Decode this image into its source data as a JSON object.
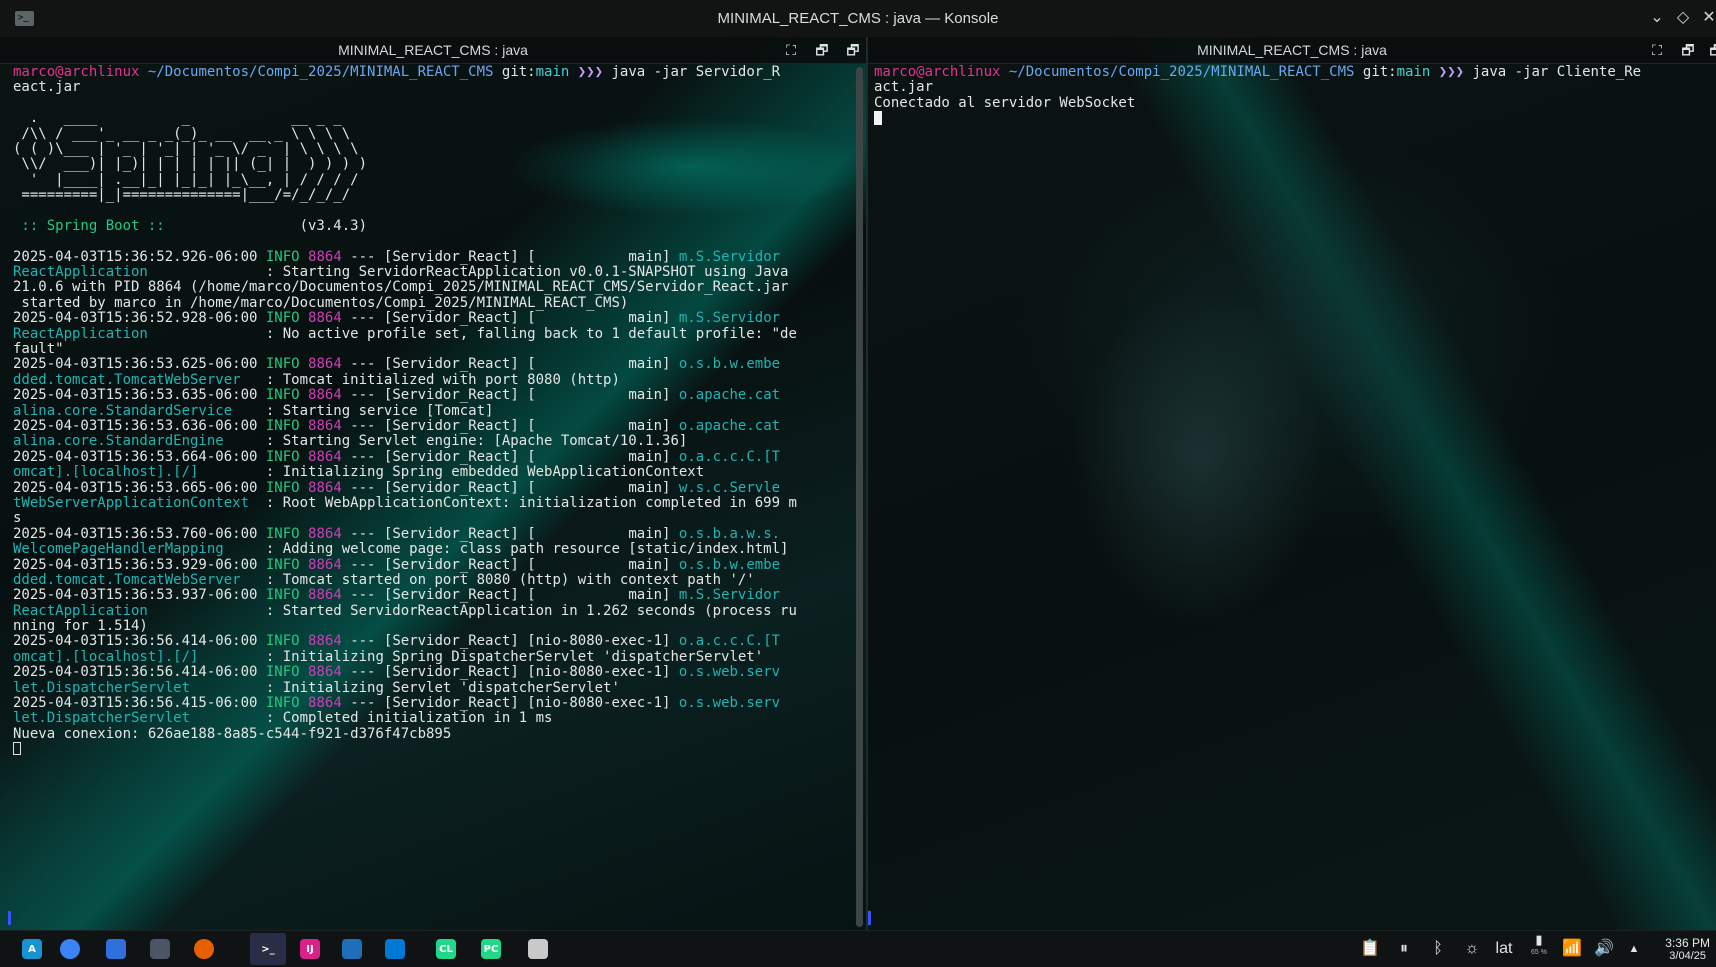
{
  "window": {
    "title": "MINIMAL_REACT_CMS : java — Konsole",
    "app_icon": "terminal-icon"
  },
  "left_pane": {
    "title": "MINIMAL_REACT_CMS : java",
    "prompt": {
      "user": "marco@archlinux",
      "path": "~/Documentos/Compi_2025/MINIMAL_REACT_CMS",
      "git": "git:",
      "branch_glyph": "",
      "branch": "main",
      "arrows": "❯❯❯",
      "command_1": "java -jar Servidor_R",
      "command_2": "eact.jar"
    },
    "banner": [
      "",
      "  .   ____          _            __ _ _",
      " /\\\\ / ___'_ __ _ _(_)_ __  __ _ \\ \\ \\ \\",
      "( ( )\\___ | '_ | '_| | '_ \\/ _` | \\ \\ \\ \\",
      " \\\\/  ___)| |_)| | | | | || (_| |  ) ) ) )",
      "  '  |____| .__|_| |_|_| |_\\__, | / / / /",
      " =========|_|==============|___/=/_/_/_/",
      ""
    ],
    "spring_label": " :: Spring Boot ::",
    "spring_version": "                (v3.4.3)",
    "logs": [
      [
        "2025-04-03T15:36:52.926-06:00",
        "INFO",
        "8864",
        "--- [Servidor_React] [           main]",
        "m.S.Servidor"
      ],
      [
        "ReactApplication             ",
        "",
        "",
        ": Starting ServidorReactApplication v0.0.1-SNAPSHOT using Java",
        ""
      ],
      [
        "21.0.6 with PID 8864 (/home/marco/Documentos/Compi_2025/MINIMAL_REACT_CMS/Servidor_React.jar",
        "",
        "",
        "",
        ""
      ],
      [
        " started by marco in /home/marco/Documentos/Compi_2025/MINIMAL_REACT_CMS)",
        "",
        "",
        "",
        ""
      ],
      [
        "2025-04-03T15:36:52.928-06:00",
        "INFO",
        "8864",
        "--- [Servidor_React] [           main]",
        "m.S.Servidor"
      ],
      [
        "ReactApplication             ",
        "",
        "",
        ": No active profile set, falling back to 1 default profile: \"de",
        ""
      ],
      [
        "fault\"",
        "",
        "",
        "",
        ""
      ],
      [
        "2025-04-03T15:36:53.625-06:00",
        "INFO",
        "8864",
        "--- [Servidor_React] [           main]",
        "o.s.b.w.embe"
      ],
      [
        "dded.tomcat.TomcatWebServer  ",
        "",
        "",
        ": Tomcat initialized with port 8080 (http)",
        ""
      ],
      [
        "2025-04-03T15:36:53.635-06:00",
        "INFO",
        "8864",
        "--- [Servidor_React] [           main]",
        "o.apache.cat"
      ],
      [
        "alina.core.StandardService   ",
        "",
        "",
        ": Starting service [Tomcat]",
        ""
      ],
      [
        "2025-04-03T15:36:53.636-06:00",
        "INFO",
        "8864",
        "--- [Servidor_React] [           main]",
        "o.apache.cat"
      ],
      [
        "alina.core.StandardEngine    ",
        "",
        "",
        ": Starting Servlet engine: [Apache Tomcat/10.1.36]",
        ""
      ],
      [
        "2025-04-03T15:36:53.664-06:00",
        "INFO",
        "8864",
        "--- [Servidor_React] [           main]",
        "o.a.c.c.C.[T"
      ],
      [
        "omcat].[localhost].[/]       ",
        "",
        "",
        ": Initializing Spring embedded WebApplicationContext",
        ""
      ],
      [
        "2025-04-03T15:36:53.665-06:00",
        "INFO",
        "8864",
        "--- [Servidor_React] [           main]",
        "w.s.c.Servle"
      ],
      [
        "tWebServerApplicationContext ",
        "",
        "",
        ": Root WebApplicationContext: initialization completed in 699 m",
        ""
      ],
      [
        "s",
        "",
        "",
        "",
        ""
      ],
      [
        "2025-04-03T15:36:53.760-06:00",
        "INFO",
        "8864",
        "--- [Servidor_React] [           main]",
        "o.s.b.a.w.s."
      ],
      [
        "WelcomePageHandlerMapping    ",
        "",
        "",
        ": Adding welcome page: class path resource [static/index.html]",
        ""
      ],
      [
        "2025-04-03T15:36:53.929-06:00",
        "INFO",
        "8864",
        "--- [Servidor_React] [           main]",
        "o.s.b.w.embe"
      ],
      [
        "dded.tomcat.TomcatWebServer  ",
        "",
        "",
        ": Tomcat started on port 8080 (http) with context path '/'",
        ""
      ],
      [
        "2025-04-03T15:36:53.937-06:00",
        "INFO",
        "8864",
        "--- [Servidor_React] [           main]",
        "m.S.Servidor"
      ],
      [
        "ReactApplication             ",
        "",
        "",
        ": Started ServidorReactApplication in 1.262 seconds (process ru",
        ""
      ],
      [
        "nning for 1.514)",
        "",
        "",
        "",
        ""
      ],
      [
        "2025-04-03T15:36:56.414-06:00",
        "INFO",
        "8864",
        "--- [Servidor_React] [nio-8080-exec-1]",
        "o.a.c.c.C.[T"
      ],
      [
        "omcat].[localhost].[/]       ",
        "",
        "",
        ": Initializing Spring DispatcherServlet 'dispatcherServlet'",
        ""
      ],
      [
        "2025-04-03T15:36:56.414-06:00",
        "INFO",
        "8864",
        "--- [Servidor_React] [nio-8080-exec-1]",
        "o.s.web.serv"
      ],
      [
        "let.DispatcherServlet        ",
        "",
        "",
        ": Initializing Servlet 'dispatcherServlet'",
        ""
      ],
      [
        "2025-04-03T15:36:56.415-06:00",
        "INFO",
        "8864",
        "--- [Servidor_React] [nio-8080-exec-1]",
        "o.s.web.serv"
      ],
      [
        "let.DispatcherServlet        ",
        "",
        "",
        ": Completed initialization in 1 ms",
        ""
      ],
      [
        "Nueva conexion: 626ae188-8a85-c544-f921-d376f47cb895",
        "",
        "",
        "",
        ""
      ]
    ]
  },
  "right_pane": {
    "title": "MINIMAL_REACT_CMS : java",
    "prompt": {
      "user": "marco@archlinux",
      "path": "~/Documentos/Compi_2025/MINIMAL_REACT_CMS",
      "git": "git:",
      "branch_glyph": "",
      "branch": "main",
      "arrows": "❯❯❯",
      "command_1": "java -jar Cliente_Re",
      "command_2": "act.jar"
    },
    "output": "Conectado al servidor WebSocket"
  },
  "taskbar": {
    "apps": [
      {
        "name": "arch-launcher-icon",
        "color": "#1793d1",
        "label": "A"
      },
      {
        "name": "chromium-icon",
        "color": "#3b82f6",
        "label": ""
      },
      {
        "name": "discover-icon",
        "color": "#2f6fdc",
        "label": ""
      },
      {
        "name": "dolphin-files-icon",
        "color": "#4b5563",
        "label": ""
      },
      {
        "name": "firefox-icon",
        "color": "#e66000",
        "label": ""
      },
      {
        "name": "konsole-icon",
        "color": "#2b2d42",
        "label": ">_"
      },
      {
        "name": "intellij-icon",
        "color": "#d8228a",
        "label": "IJ"
      },
      {
        "name": "virtualbox-icon",
        "color": "#1f6fb8",
        "label": ""
      },
      {
        "name": "vscode-icon",
        "color": "#0078d4",
        "label": ""
      },
      {
        "name": "clion-icon",
        "color": "#21d789",
        "label": "CL"
      },
      {
        "name": "pycharm-icon",
        "color": "#21d789",
        "label": "PC"
      },
      {
        "name": "drawing-app-icon",
        "color": "#c9c9c9",
        "label": ""
      }
    ],
    "tray": {
      "keyboard_layout": "lat",
      "battery_percent": "65 %",
      "time": "3:36 PM",
      "date": "3/04/25"
    }
  }
}
